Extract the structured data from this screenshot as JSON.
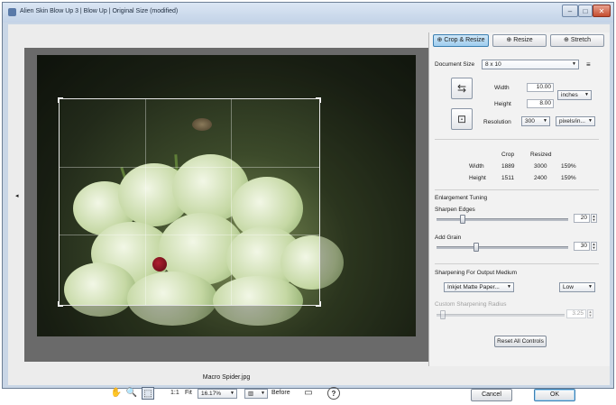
{
  "window": {
    "title": "Alien Skin Blow Up 3 | Blow Up | Original Size (modified)",
    "controls": {
      "minimize": "–",
      "maximize": "□",
      "close": "✕"
    }
  },
  "preview": {
    "filename": "Macro Spider.jpg",
    "left_arrow": "◂",
    "right_arrow": "▸"
  },
  "toolbar": {
    "hand_icon": "✋",
    "zoom_icon": "🔍",
    "select_icon": "⬚",
    "one_to_one": "1:1",
    "fit": "Fit",
    "zoom_value": "16.17%",
    "split_icon": "▥",
    "before_label": "Before",
    "compare_icon": "▭",
    "help_icon": "?",
    "cancel_label": "Cancel",
    "ok_label": "OK"
  },
  "panel": {
    "tabs": [
      {
        "label": "Crop & Resize",
        "icon": "⊕",
        "selected": true
      },
      {
        "label": "Resize",
        "icon": "⊕",
        "selected": false
      },
      {
        "label": "Stretch",
        "icon": "⊕",
        "selected": false
      }
    ],
    "document_size": {
      "label": "Document Size",
      "value": "8 x 10",
      "menu_icon": "≡"
    },
    "width": {
      "label": "Width",
      "value": "10.00"
    },
    "height": {
      "label": "Height",
      "value": "8.00"
    },
    "units": "inches",
    "resolution": {
      "label": "Resolution",
      "value": "300",
      "units": "pixels/in..."
    },
    "stats": {
      "col_crop": "Crop",
      "col_resized": "Resized",
      "rows": [
        {
          "label": "Width",
          "crop": "1889",
          "resized": "3000",
          "pct": "159%"
        },
        {
          "label": "Height",
          "crop": "1511",
          "resized": "2400",
          "pct": "159%"
        }
      ]
    },
    "enlargement": {
      "heading": "Enlargement Tuning",
      "sharpen_edges": {
        "label": "Sharpen Edges",
        "value": "20",
        "level": 0.2
      },
      "add_grain": {
        "label": "Add Grain",
        "value": "30",
        "level": 0.3
      }
    },
    "sharpening": {
      "heading": "Sharpening For Output Medium",
      "medium": "Inkjet Matte Paper...",
      "strength": "Low",
      "custom_label": "Custom Sharpening Radius",
      "custom_value": "3.25",
      "custom_level": 0.05
    },
    "reset_label": "Reset All Controls"
  }
}
